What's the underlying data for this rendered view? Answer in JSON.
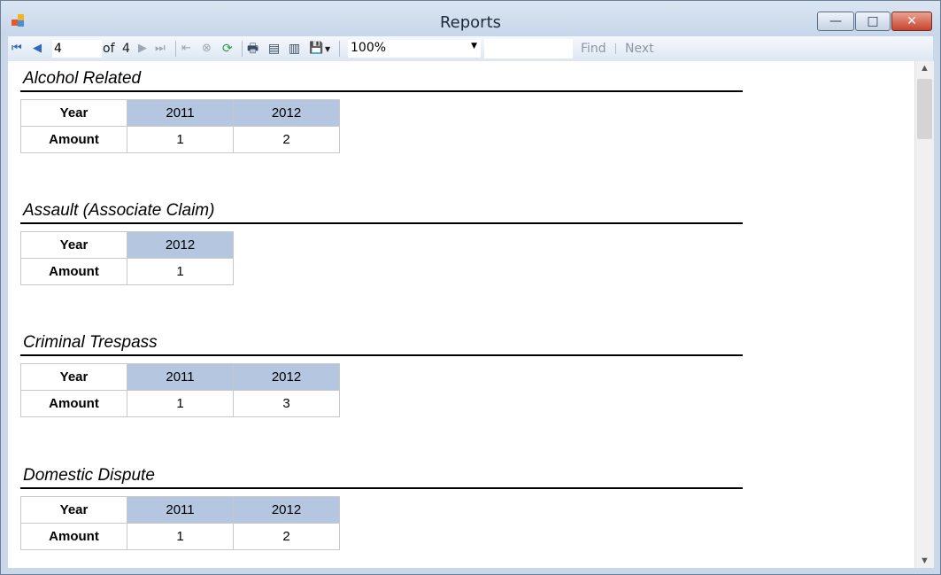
{
  "window": {
    "title": "Reports",
    "min_label": "—",
    "max_label": "□",
    "close_label": "✕"
  },
  "toolbar": {
    "first_icon": "⏮",
    "prev_icon": "◀",
    "next_icon": "▶",
    "last_icon": "⏭",
    "current_page": "4",
    "of_label": "of",
    "total_pages": "4",
    "back_icon": "⇤",
    "stop_icon": "⊗",
    "refresh_icon": "⟳",
    "print_icon": "🖶",
    "layout_icon": "▤",
    "pagesetup_icon": "▥",
    "export_icon": "💾",
    "zoom": "100%",
    "find_label": "Find",
    "next_label": "Next"
  },
  "sections": [
    {
      "title": "Alcohol Related",
      "year_label": "Year",
      "amount_label": "Amount",
      "years": [
        "2011",
        "2012"
      ],
      "amounts": [
        "1",
        "2"
      ]
    },
    {
      "title": "Assault (Associate Claim)",
      "year_label": "Year",
      "amount_label": "Amount",
      "years": [
        "2012"
      ],
      "amounts": [
        "1"
      ]
    },
    {
      "title": "Criminal Trespass",
      "year_label": "Year",
      "amount_label": "Amount",
      "years": [
        "2011",
        "2012"
      ],
      "amounts": [
        "1",
        "3"
      ]
    },
    {
      "title": "Domestic Dispute",
      "year_label": "Year",
      "amount_label": "Amount",
      "years": [
        "2011",
        "2012"
      ],
      "amounts": [
        "1",
        "2"
      ]
    }
  ],
  "colors": {
    "year_header_bg": "#b4c6e0"
  }
}
